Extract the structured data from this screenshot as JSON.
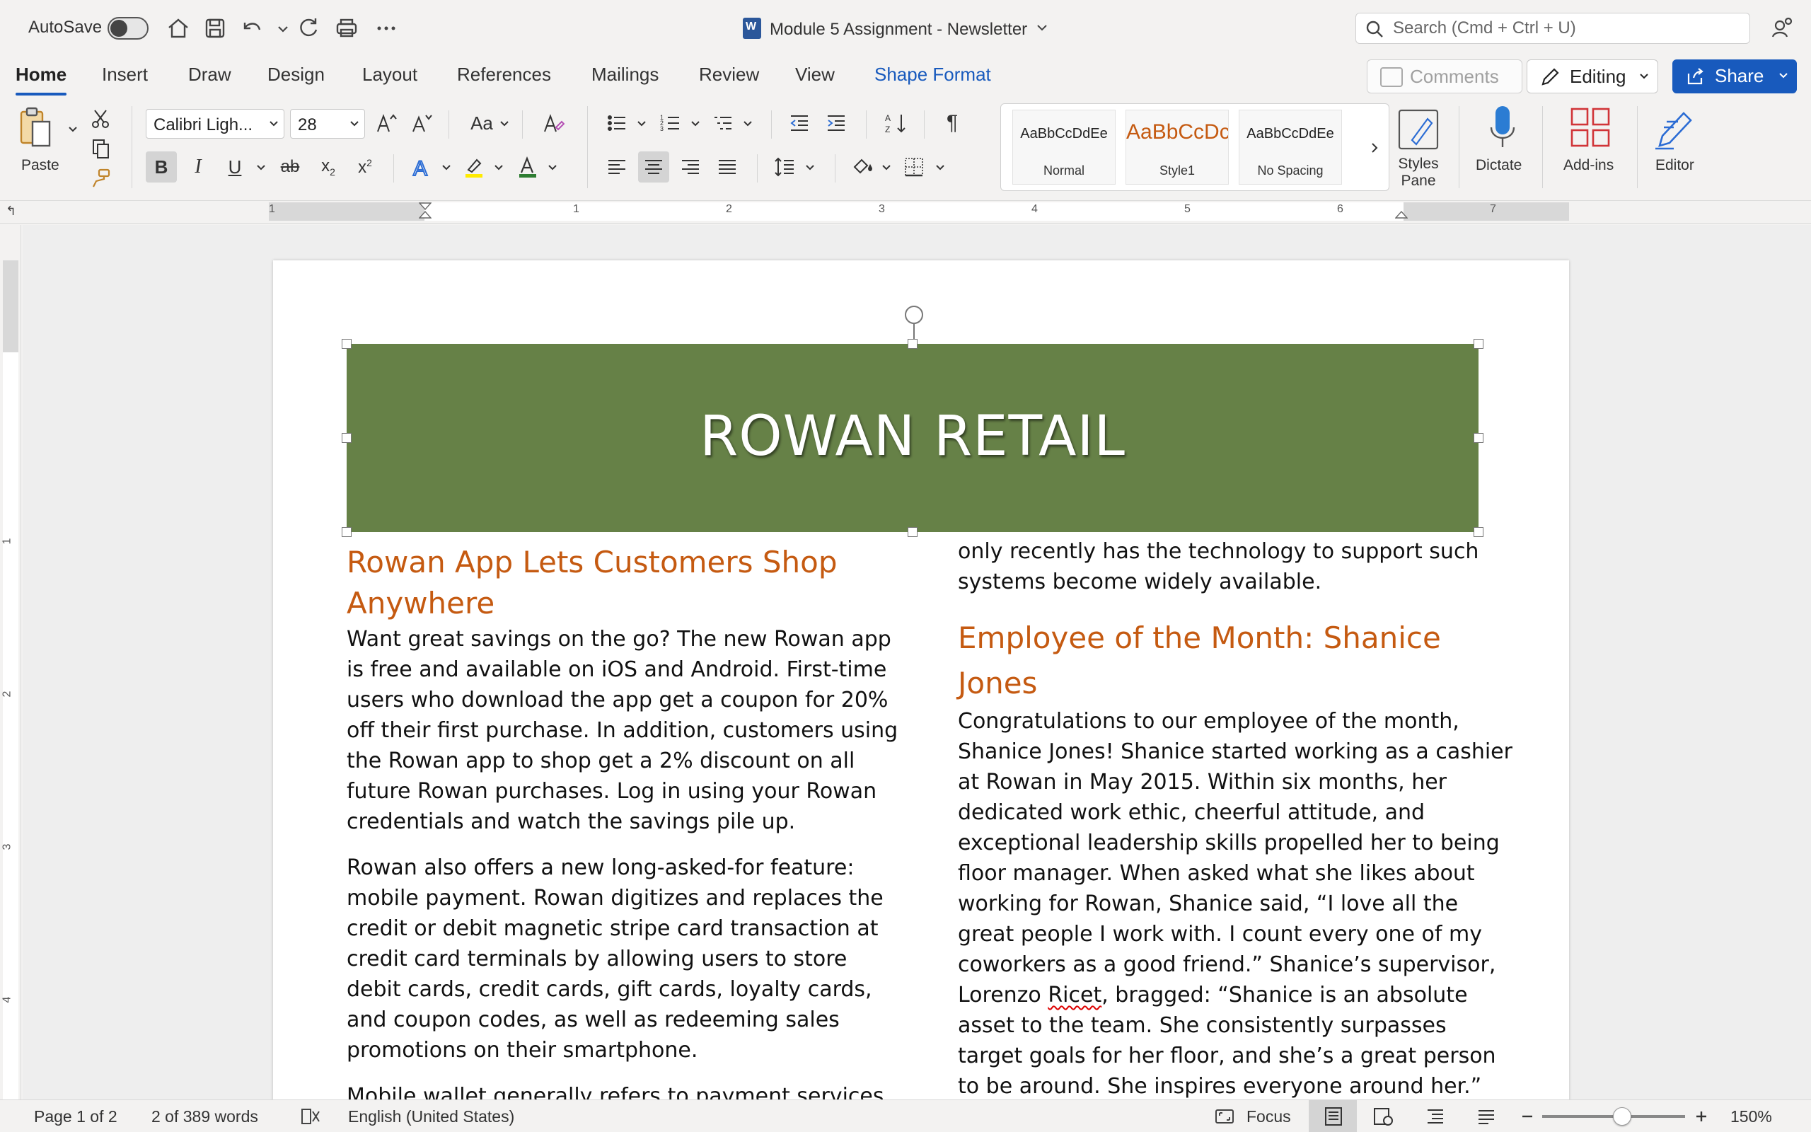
{
  "titlebar": {
    "autosave_label": "AutoSave",
    "document_title": "Module 5 Assignment - Newsletter",
    "search_placeholder": "Search (Cmd + Ctrl + U)"
  },
  "tabs": [
    {
      "label": "Home"
    },
    {
      "label": "Insert"
    },
    {
      "label": "Draw"
    },
    {
      "label": "Design"
    },
    {
      "label": "Layout"
    },
    {
      "label": "References"
    },
    {
      "label": "Mailings"
    },
    {
      "label": "Review"
    },
    {
      "label": "View"
    },
    {
      "label": "Shape Format"
    }
  ],
  "header_buttons": {
    "comments": "Comments",
    "editing": "Editing",
    "share": "Share"
  },
  "ribbon": {
    "paste_label": "Paste",
    "font_name": "Calibri Ligh...",
    "font_size": "28",
    "change_case": "Aa",
    "styles": [
      {
        "preview": "AaBbCcDdEe",
        "name": "Normal"
      },
      {
        "preview": "AaBbCcDc",
        "name": "Style1"
      },
      {
        "preview": "AaBbCcDdEe",
        "name": "No Spacing"
      }
    ],
    "styles_pane_label": "Styles Pane",
    "dictate_label": "Dictate",
    "addins_label": "Add-ins",
    "editor_label": "Editor"
  },
  "ruler": {
    "h_numbers": [
      "1",
      "1",
      "2",
      "3",
      "4",
      "5",
      "6",
      "7"
    ],
    "v_numbers": [
      "1",
      "2",
      "3",
      "4"
    ]
  },
  "document": {
    "banner_title": "ROWAN RETAIL",
    "left": {
      "heading": "Rowan App Lets Customers Shop Anywhere",
      "p1": "Want great savings on the go? The new Rowan app is free and available on iOS and Android. First-time users who download the app get a coupon for 20% off their first purchase. In addition, customers using the Rowan app to shop get a 2% discount on all future Rowan purchases. Log in using your Rowan credentials and watch the savings pile up.",
      "p2": "Rowan also offers a new long-asked-for feature: mobile payment. Rowan digitizes and replaces the credit or debit magnetic stripe card transaction at credit card terminals by allowing users to store debit cards, credit cards, gift cards, loyalty cards, and coupon codes, as well as redeeming sales promotions on their smartphone.",
      "p3": "Mobile wallet generally refers to payment services"
    },
    "right": {
      "p0": "only recently has the technology to support such systems become widely available.",
      "heading": "Employee of the Month: Shanice Jones",
      "p1_a": "Congratulations to our employee of the month, Shanice Jones! Shanice started working as a cashier at Rowan in May 2015. Within six months, her dedicated work ethic, cheerful attitude, and exceptional leadership skills propelled her to being floor manager. When asked what she likes about working for Rowan, Shanice said, “I love all the great people I work with. I count every one of my coworkers as a good friend.” Shanice’s supervisor, Lorenzo ",
      "p1_misspelled": "Ricet",
      "p1_b": ", bragged: “Shanice is an absolute asset to the team. She consistently surpasses target goals for her floor, and she’s a great person to be around. She inspires everyone around her.”"
    }
  },
  "statusbar": {
    "page": "Page 1 of 2",
    "words": "2 of 389 words",
    "language": "English (United States)",
    "focus": "Focus",
    "zoom": "150%"
  },
  "colors": {
    "accent": "#185abd",
    "banner": "#668147",
    "heading": "#c55a11"
  }
}
